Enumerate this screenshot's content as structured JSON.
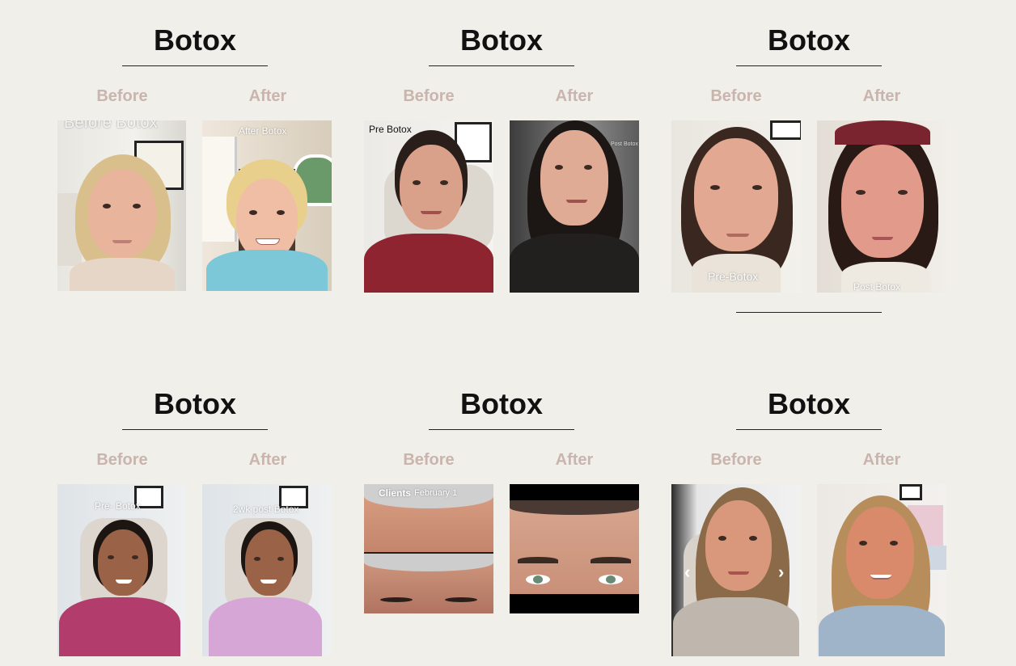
{
  "cards": [
    {
      "title": "Botox",
      "before_label": "Before",
      "after_label": "After",
      "before_caption": "Before Botox",
      "after_caption": "After Botox"
    },
    {
      "title": "Botox",
      "before_label": "Before",
      "after_label": "After",
      "before_caption": "Pre Botox",
      "after_caption": "Post Botox"
    },
    {
      "title": "Botox",
      "before_label": "Before",
      "after_label": "After",
      "before_caption": "Pre-Botox",
      "after_caption": "Post Botox"
    },
    {
      "title": "Botox",
      "before_label": "Before",
      "after_label": "After",
      "before_caption": "Pre- Botox",
      "after_caption": "2wk post Botox"
    },
    {
      "title": "Botox",
      "before_label": "Before",
      "after_label": "After",
      "before_caption": "Clients",
      "before_caption_date": "February 1",
      "after_caption": ""
    },
    {
      "title": "Botox",
      "before_label": "Before",
      "after_label": "After",
      "before_caption": "",
      "after_caption": ""
    }
  ],
  "carousel": {
    "prev_icon": "chevron-left-icon",
    "next_icon": "chevron-right-icon",
    "prev_glyph": "‹",
    "next_glyph": "›"
  },
  "colors": {
    "background": "#f0efea",
    "label": "#c9b5ad",
    "title": "#111111"
  }
}
